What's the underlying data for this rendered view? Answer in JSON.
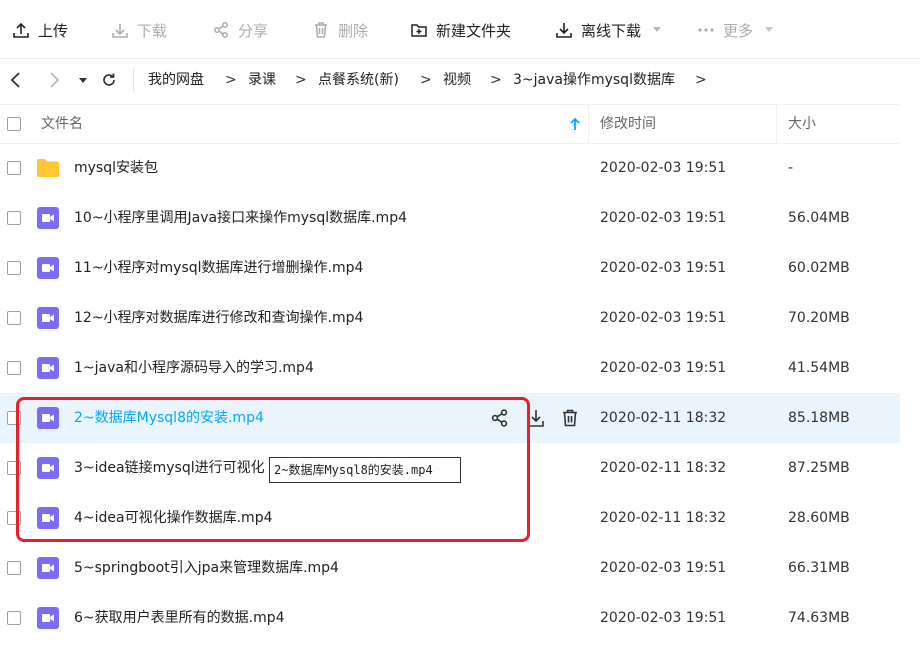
{
  "toolbar": {
    "upload": "上传",
    "download": "下载",
    "share": "分享",
    "delete": "删除",
    "new_folder": "新建文件夹",
    "offline_download": "离线下载",
    "more": "更多"
  },
  "breadcrumb": [
    "我的网盘",
    "录课",
    "点餐系统(新)",
    "视频",
    "3~java操作mysql数据库"
  ],
  "columns": {
    "name": "文件名",
    "modified": "修改时间",
    "size": "大小"
  },
  "rows": [
    {
      "name": "mysql安装包",
      "time": "2020-02-03 19:51",
      "size": "-",
      "type": "folder"
    },
    {
      "name": "10~小程序里调用Java接口来操作mysql数据库.mp4",
      "time": "2020-02-03 19:51",
      "size": "56.04MB",
      "type": "video"
    },
    {
      "name": "11~小程序对mysql数据库进行增删操作.mp4",
      "time": "2020-02-03 19:51",
      "size": "60.02MB",
      "type": "video"
    },
    {
      "name": "12~小程序对数据库进行修改和查询操作.mp4",
      "time": "2020-02-03 19:51",
      "size": "70.20MB",
      "type": "video"
    },
    {
      "name": "1~java和小程序源码导入的学习.mp4",
      "time": "2020-02-03 19:51",
      "size": "41.54MB",
      "type": "video"
    },
    {
      "name": "2~数据库Mysql8的安装.mp4",
      "time": "2020-02-11 18:32",
      "size": "85.18MB",
      "type": "video"
    },
    {
      "name": "3~idea链接mysql进行可视化",
      "time": "2020-02-11 18:32",
      "size": "87.25MB",
      "type": "video"
    },
    {
      "name": "4~idea可视化操作数据库.mp4",
      "time": "2020-02-11 18:32",
      "size": "28.60MB",
      "type": "video"
    },
    {
      "name": "5~springboot引入jpa来管理数据库.mp4",
      "time": "2020-02-03 19:51",
      "size": "66.31MB",
      "type": "video"
    },
    {
      "name": "6~获取用户表里所有的数据.mp4",
      "time": "2020-02-03 19:51",
      "size": "74.63MB",
      "type": "video"
    }
  ],
  "tooltip": "2~数据库Mysql8的安装.mp4",
  "colors": {
    "accent": "#06a7ff",
    "video_icon": "#7b6cf6",
    "folder_icon": "#ffc832",
    "highlight_box": "#e8202a"
  }
}
